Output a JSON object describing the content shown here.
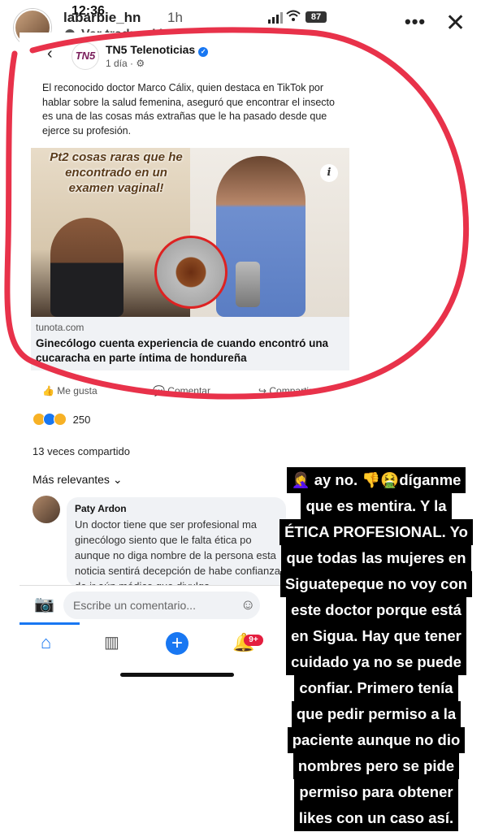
{
  "story": {
    "username": "labarbie_hn",
    "time_ago": "1h",
    "translate_label": "Ver traducción",
    "status_time": "12:36",
    "battery": "87",
    "more_label": "•••",
    "close_label": "✕"
  },
  "post": {
    "page_name": "TN5 Telenoticias",
    "page_logo_text": "TN5",
    "date": "1 día · ⚙",
    "text": "El reconocido doctor Marco Cálix, quien destaca en TikTok por hablar sobre la salud femenina, aseguró que encontrar el insecto es una de las cosas más extrañas que le ha pasado desde que ejerce su profesión.",
    "image_overlay_text": "Pt2 cosas raras que he encontrado en un examen vaginal!",
    "info_badge": "i",
    "link_domain": "tunota.com",
    "link_title": "Ginecólogo cuenta experiencia de cuando encontró una cucaracha en parte íntima de hondureña",
    "actions": {
      "like": "Me gusta",
      "comment": "Comentar",
      "share": "Compartir"
    },
    "reaction_count": "250",
    "shares": "13 veces compartido",
    "sort_label": "Más relevantes ⌄"
  },
  "comment": {
    "author": "Paty Ardon",
    "text": "Un doctor tiene que ser profesional ma ginecólogo siento que le falta ética po aunque no diga nombre de la persona esta noticia sentirá decepción de habe confianza de ir aún médico que divulga"
  },
  "composer": {
    "placeholder": "Escribe un comentario..."
  },
  "nav": {
    "notifications_badge": "9+"
  },
  "caption_lines": [
    "🤦‍♀️ ay no. 👎🤮díganme",
    "que es mentira. Y la",
    "ÉTICA PROFESIONAL. Yo",
    "que todas las mujeres en",
    "Siguatepeque no voy con",
    "este doctor porque está",
    "en Sigua. Hay que tener",
    "cuidado ya no se puede",
    "confiar. Primero tenía",
    "que pedir permiso a la",
    "paciente aunque no dio",
    "nombres pero se pide",
    "permiso para obtener",
    "likes con un caso así."
  ],
  "colors": {
    "facebook_blue": "#1877f2",
    "annotation_red": "#e8324a",
    "caption_bg": "#000000"
  }
}
